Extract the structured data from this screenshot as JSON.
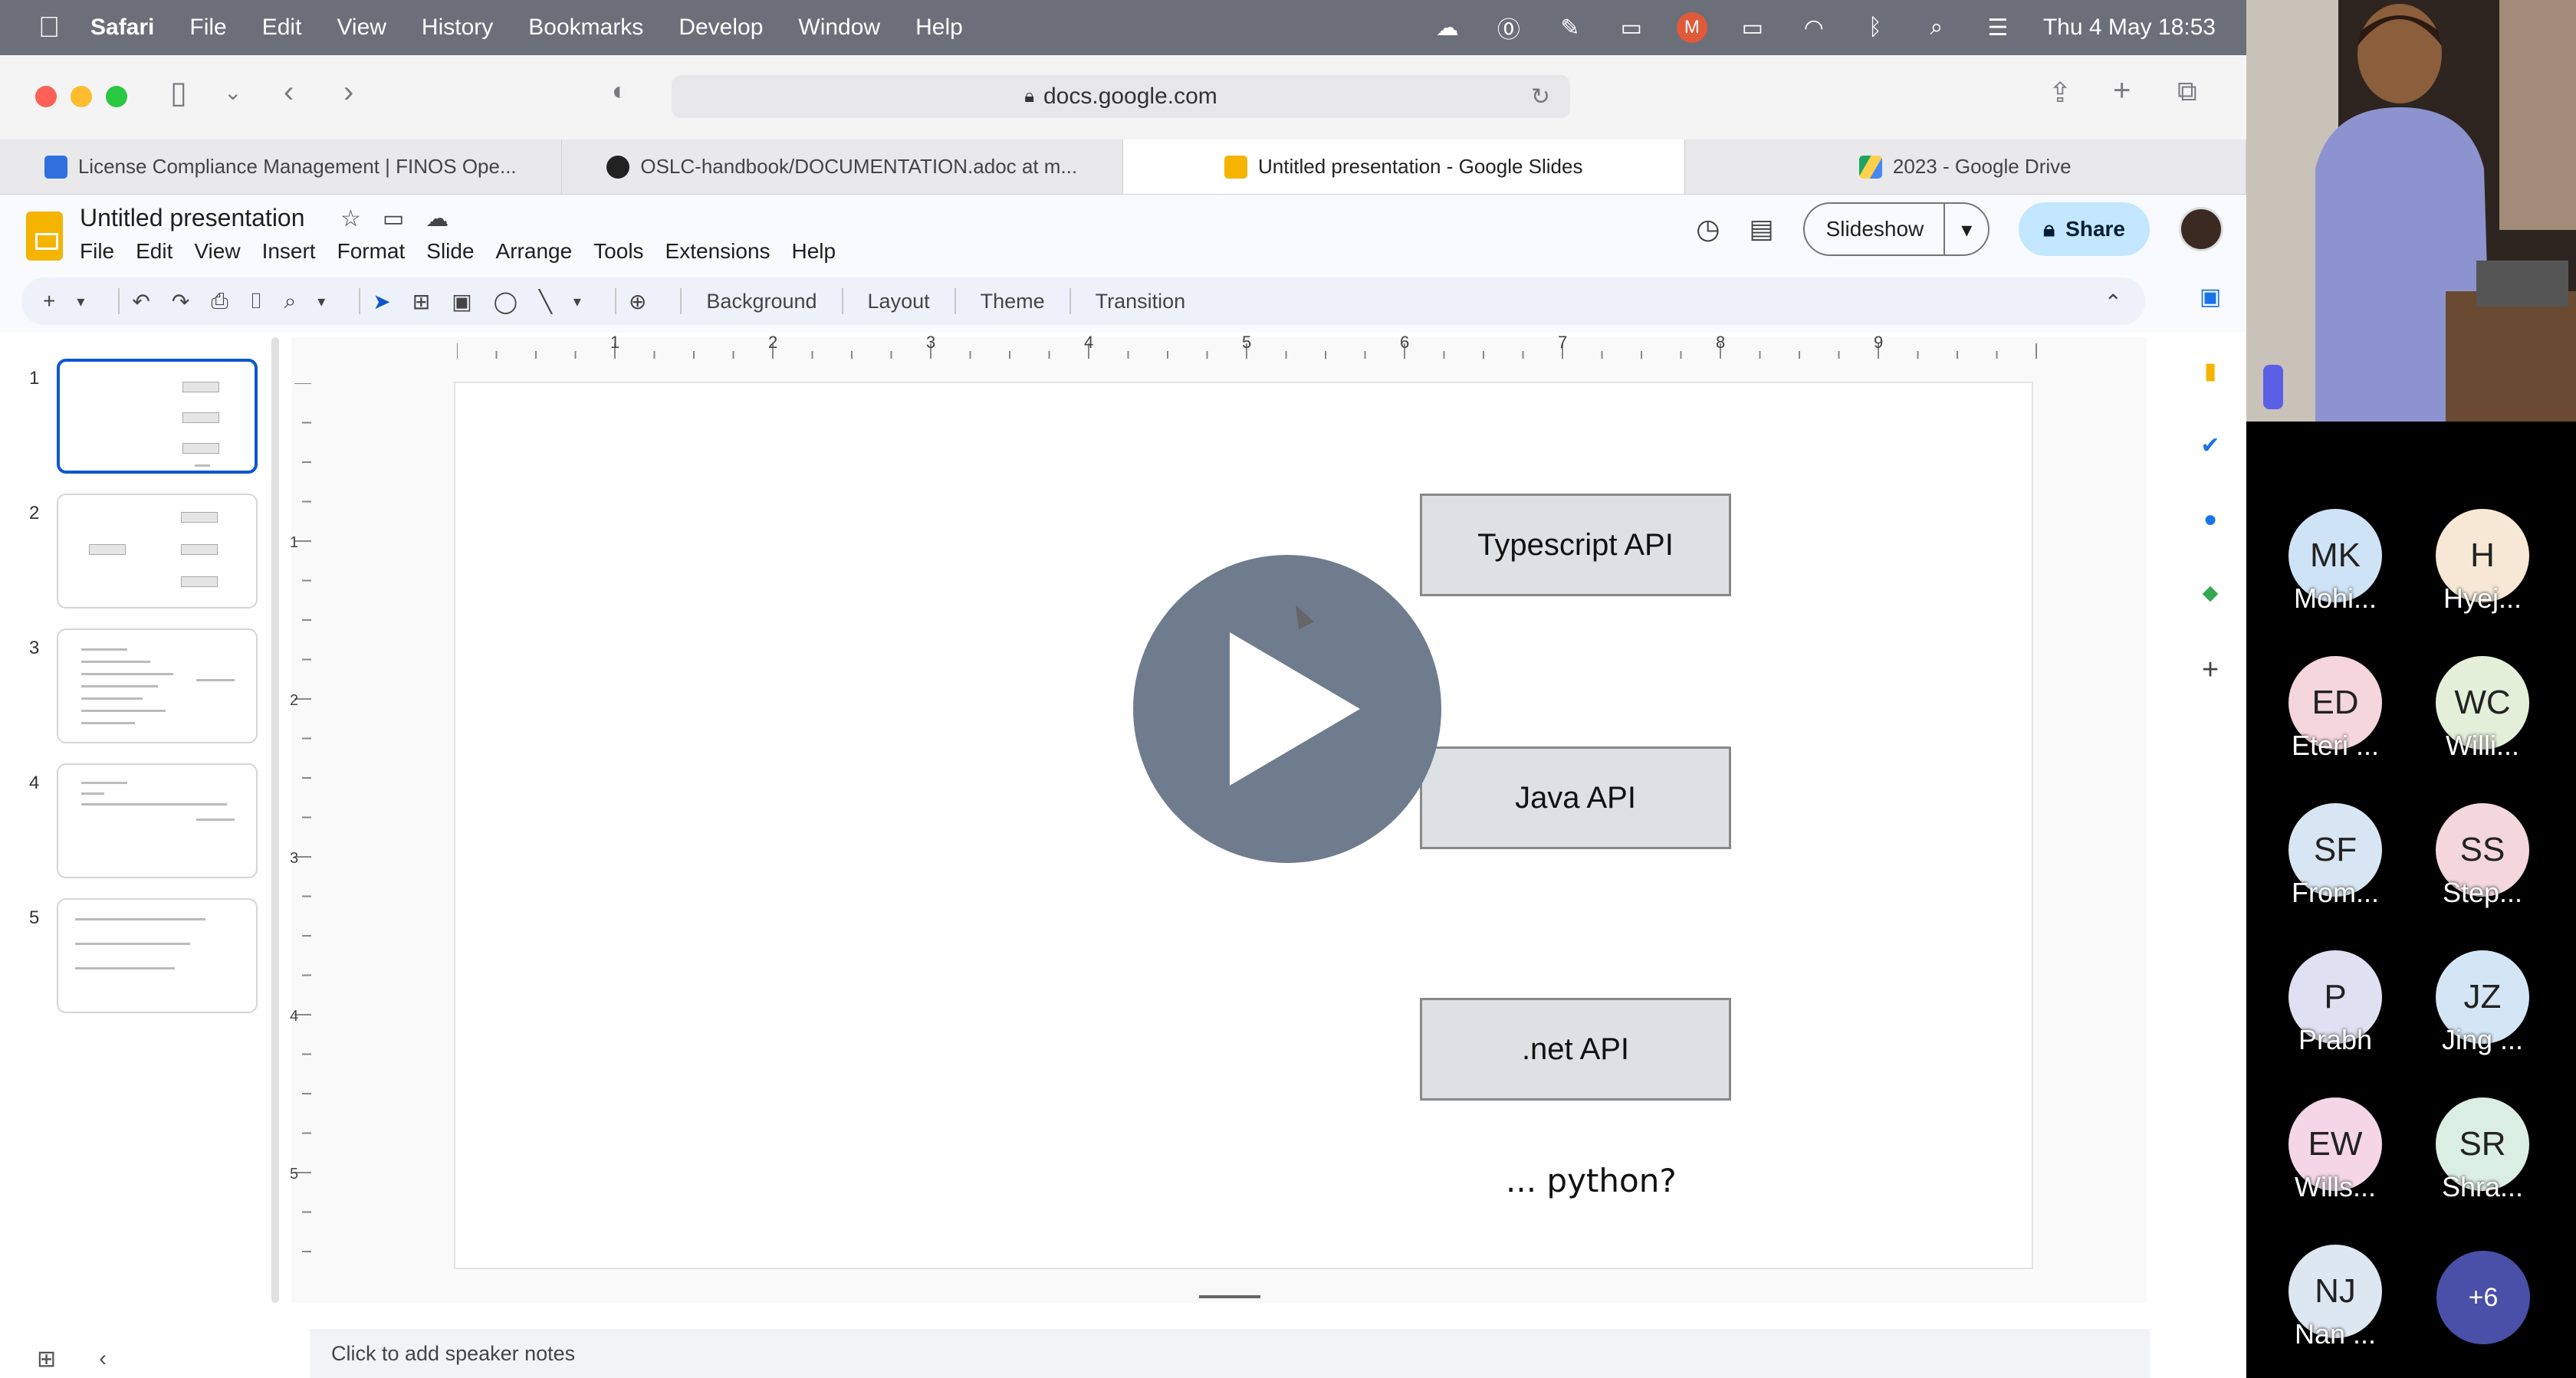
{
  "menubar": {
    "app_name": "Safari",
    "items": [
      "File",
      "Edit",
      "View",
      "History",
      "Bookmarks",
      "Develop",
      "Window",
      "Help"
    ],
    "datetime": "Thu 4 May  18:53"
  },
  "browser": {
    "url": "docs.google.com",
    "tabs": [
      {
        "label": "License Compliance Management | FINOS Ope..."
      },
      {
        "label": "OSLC-handbook/DOCUMENTATION.adoc at m..."
      },
      {
        "label": "Untitled presentation - Google Slides"
      },
      {
        "label": "2023 - Google Drive"
      }
    ]
  },
  "slides_app": {
    "doc_title": "Untitled presentation",
    "menu": [
      "File",
      "Edit",
      "View",
      "Insert",
      "Format",
      "Slide",
      "Arrange",
      "Tools",
      "Extensions",
      "Help"
    ],
    "slideshow_label": "Slideshow",
    "share_label": "Share",
    "toolbar_text": [
      "Background",
      "Layout",
      "Theme",
      "Transition"
    ],
    "ruler_h": [
      "1",
      "2",
      "3",
      "4",
      "5",
      "6",
      "7",
      "8",
      "9"
    ],
    "ruler_v": [
      "1",
      "2",
      "3",
      "4",
      "5"
    ],
    "thumb_numbers": [
      "1",
      "2",
      "3",
      "4",
      "5"
    ],
    "notes_placeholder": "Click to add speaker notes"
  },
  "slide": {
    "boxes": [
      "Typescript API",
      "Java API",
      ".net API"
    ],
    "footer_text": "... python?"
  },
  "participants": [
    {
      "initials": "MK",
      "name": "Mohi...",
      "color": "#cfe3f6"
    },
    {
      "initials": "H",
      "name": "Hyej...",
      "color": "#f6e8d4"
    },
    {
      "initials": "ED",
      "name": "Eteri ...",
      "color": "#f5d6dc"
    },
    {
      "initials": "WC",
      "name": "Willi...",
      "color": "#e3efd9"
    },
    {
      "initials": "SF",
      "name": "From...",
      "color": "#d7e6f2"
    },
    {
      "initials": "SS",
      "name": "Step...",
      "color": "#f3d7dc"
    },
    {
      "initials": "P",
      "name": "Prabh",
      "color": "#dfe0f2"
    },
    {
      "initials": "JZ",
      "name": "Jing ...",
      "color": "#d4e6f5"
    },
    {
      "initials": "EW",
      "name": "Wills...",
      "color": "#f4d6e6"
    },
    {
      "initials": "SR",
      "name": "Shra...",
      "color": "#dbeee2"
    },
    {
      "initials": "NJ",
      "name": "Nan ...",
      "color": "#dde7f1"
    }
  ],
  "more_participants": "+6"
}
